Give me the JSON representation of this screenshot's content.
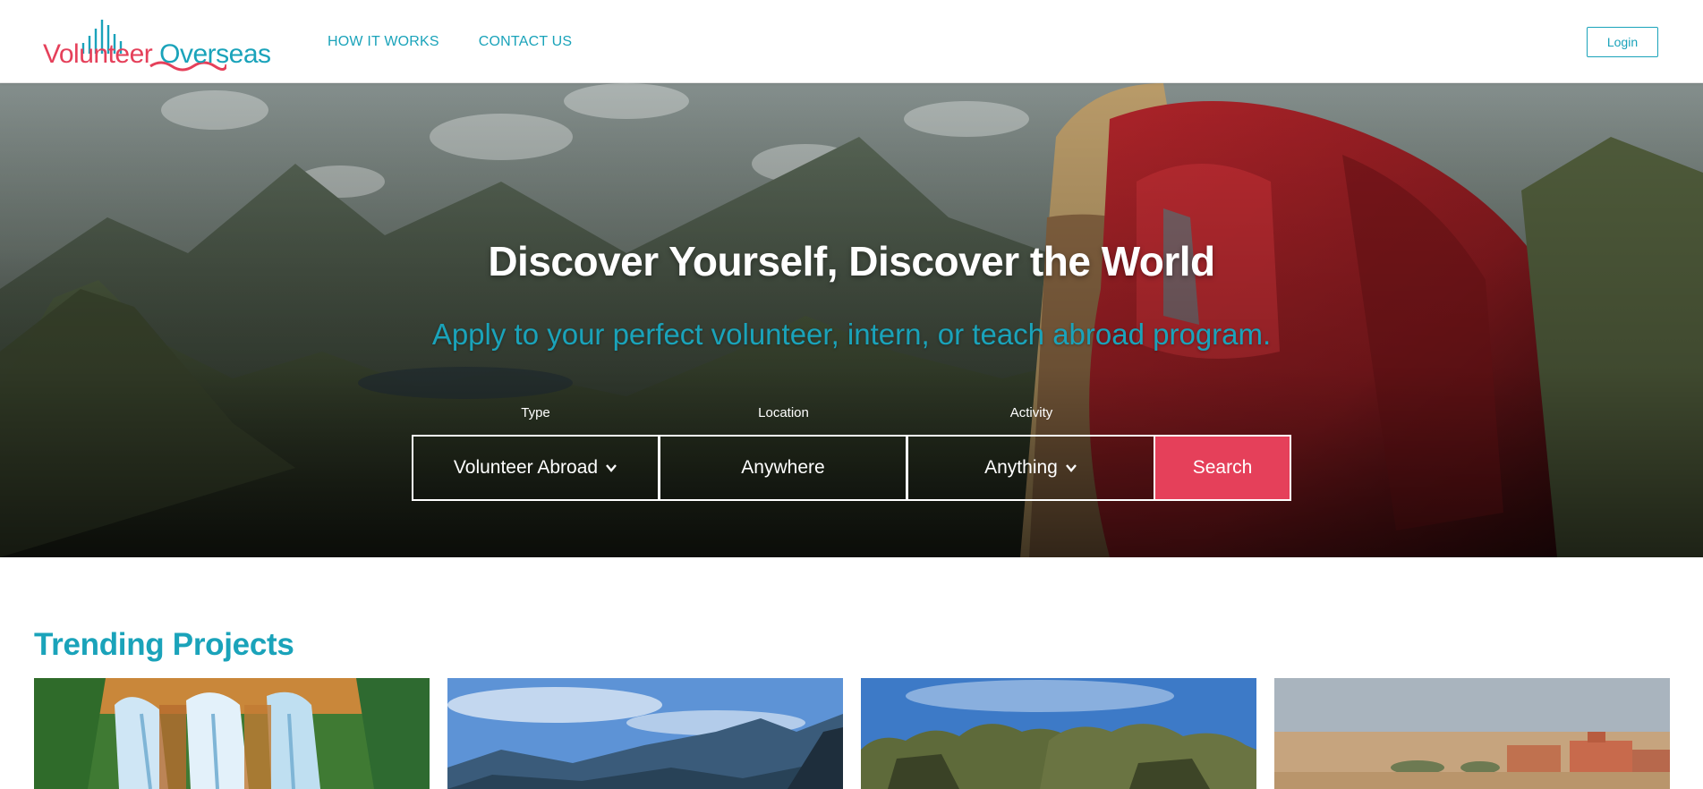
{
  "header": {
    "logo": {
      "word1": "Volunteer",
      "word2": "Overseas"
    },
    "nav": [
      {
        "label": "HOW IT WORKS"
      },
      {
        "label": "CONTACT US"
      }
    ],
    "login_label": "Login"
  },
  "hero": {
    "title": "Discover Yourself, Discover the World",
    "subtitle": "Apply to your perfect volunteer, intern, or teach abroad program.",
    "search": {
      "type_label": "Type",
      "type_value": "Volunteer Abroad",
      "location_label": "Location",
      "location_placeholder": "Anywhere",
      "activity_label": "Activity",
      "activity_value": "Anything",
      "search_label": "Search"
    }
  },
  "trending": {
    "title": "Trending Projects",
    "cards": [
      {
        "image": "waterfall-image"
      },
      {
        "image": "mountains-sky-image"
      },
      {
        "image": "rock-cliffs-image"
      },
      {
        "image": "desert-town-image"
      }
    ]
  },
  "colors": {
    "accent_teal": "#1aa3ba",
    "accent_red": "#e5405a"
  }
}
